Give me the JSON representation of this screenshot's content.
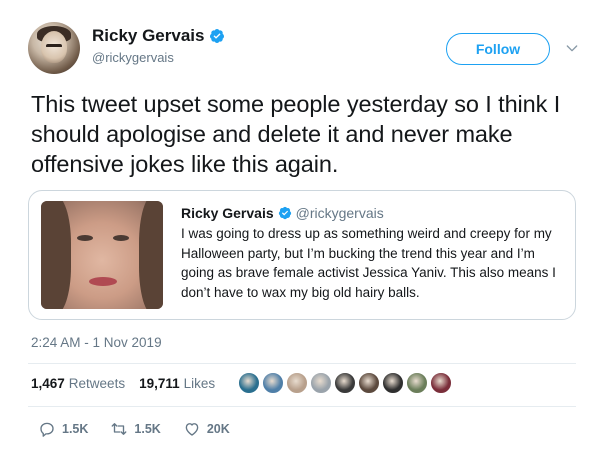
{
  "author": {
    "display_name": "Ricky Gervais",
    "handle": "@rickygervais",
    "verified": true
  },
  "follow_button": {
    "label": "Follow"
  },
  "tweet": {
    "text": "This tweet upset some people yesterday so I think I should apologise and delete it and never make offensive jokes like this again.",
    "timestamp": "2:24 AM - 1 Nov 2019"
  },
  "quoted_tweet": {
    "display_name": "Ricky Gervais",
    "handle": "@rickygervais",
    "text": "I was going to dress up as something weird and creepy for my Halloween party, but I’m bucking the trend this year and I’m going as brave female activist Jessica Yaniv. This also means I don’t have to wax my big old hairy balls."
  },
  "stats": {
    "retweets_count": "1,467",
    "retweets_label": "Retweets",
    "likes_count": "19,711",
    "likes_label": "Likes"
  },
  "liker_avatars": [
    {
      "color": "#2a6f8f"
    },
    {
      "color": "#4f7fa8"
    },
    {
      "color": "#b8a08c"
    },
    {
      "color": "#9aa3ab"
    },
    {
      "color": "#3a3a3a"
    },
    {
      "color": "#5c4a3e"
    },
    {
      "color": "#2f2f2f"
    },
    {
      "color": "#6b7e5a"
    },
    {
      "color": "#7a2e3a"
    }
  ],
  "actions": {
    "reply_count": "1.5K",
    "retweet_count": "1.5K",
    "like_count": "20K"
  },
  "colors": {
    "accent": "#1da1f2",
    "muted": "#657786",
    "text": "#14171a",
    "border": "#ccd6dd"
  },
  "icons": [
    "verified-badge-icon",
    "chevron-down-icon",
    "reply-icon",
    "retweet-icon",
    "heart-icon"
  ]
}
